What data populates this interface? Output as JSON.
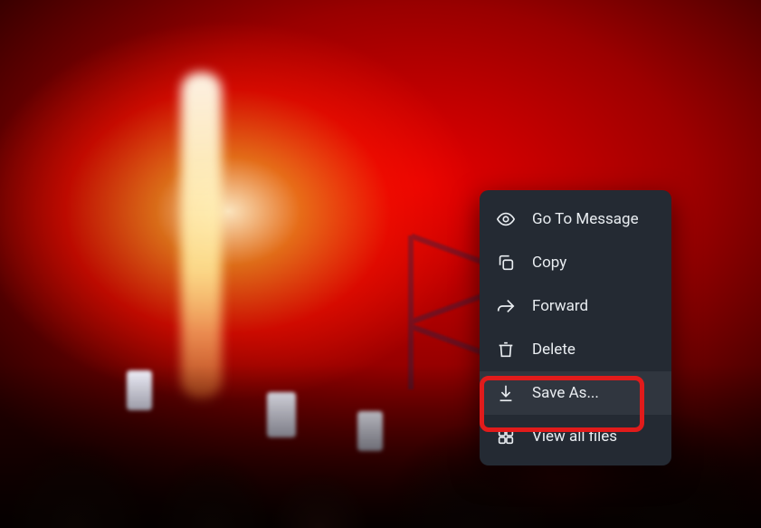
{
  "context_menu": {
    "items": [
      {
        "id": "go-to-message",
        "label": "Go To Message",
        "icon": "eye-icon"
      },
      {
        "id": "copy",
        "label": "Copy",
        "icon": "copy-icon"
      },
      {
        "id": "forward",
        "label": "Forward",
        "icon": "forward-arrow-icon"
      },
      {
        "id": "delete",
        "label": "Delete",
        "icon": "trash-icon"
      },
      {
        "id": "save-as",
        "label": "Save As...",
        "icon": "download-icon",
        "highlighted": true,
        "hovered": true
      },
      {
        "id": "view-all-files",
        "label": "View all files",
        "icon": "grid-icon"
      }
    ]
  },
  "colors": {
    "menu_bg": "#242a33",
    "menu_text": "#e9edf1",
    "highlight_border": "#e11b1b"
  }
}
